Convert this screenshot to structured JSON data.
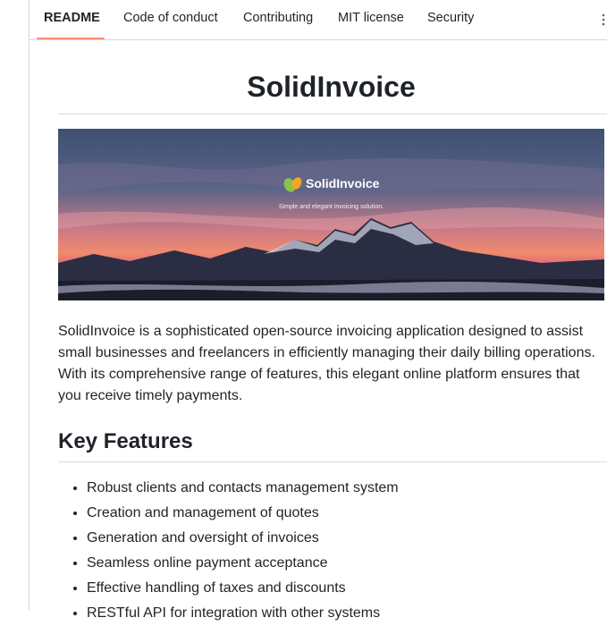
{
  "tabs": [
    {
      "label": "README",
      "active": true
    },
    {
      "label": "Code of conduct",
      "active": false
    },
    {
      "label": "Contributing",
      "active": false
    },
    {
      "label": "MIT license",
      "active": false
    },
    {
      "label": "Security",
      "active": false
    }
  ],
  "more_menu_icon": "kebab-vertical-icon",
  "readme": {
    "title": "SolidInvoice",
    "banner": {
      "logo_text": "SolidInvoice",
      "tagline": "Simple and elegant invoicing solution."
    },
    "intro": "SolidInvoice is a sophisticated open-source invoicing application designed to assist small businesses and freelancers in efficiently managing their daily billing operations. With its comprehensive range of features, this elegant online platform ensures that you receive timely payments.",
    "features_heading": "Key Features",
    "features": [
      "Robust clients and contacts management system",
      "Creation and management of quotes",
      "Generation and oversight of invoices",
      "Seamless online payment acceptance",
      "Effective handling of taxes and discounts",
      "RESTful API for integration with other systems"
    ]
  },
  "colors": {
    "active_tab_underline": "#fd8c73",
    "text": "#1f2328",
    "border": "#d0d7de"
  }
}
